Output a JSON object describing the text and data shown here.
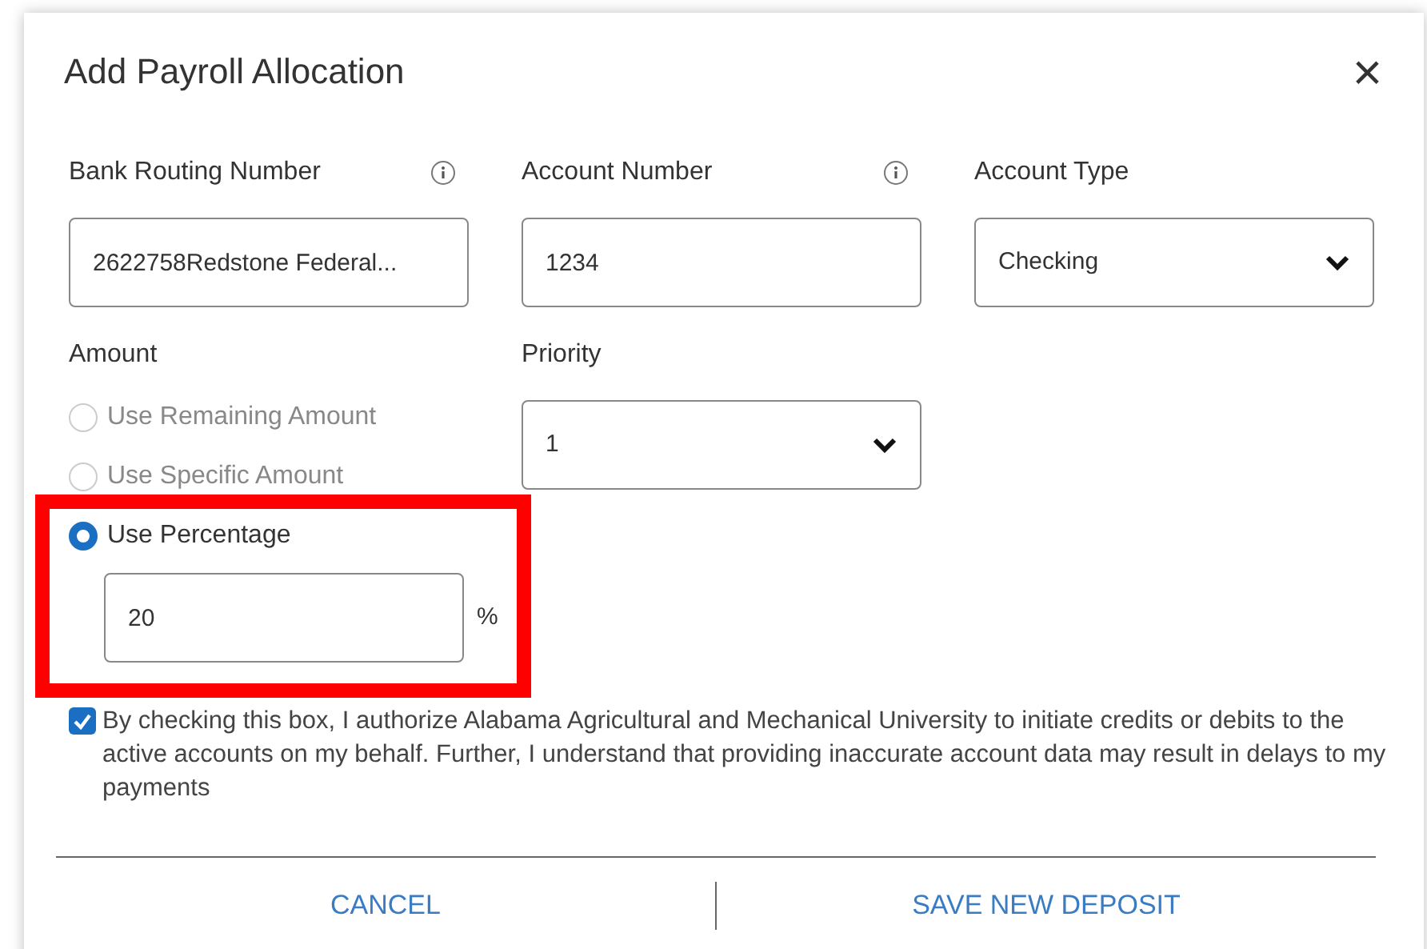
{
  "dialog": {
    "title": "Add Payroll Allocation",
    "close": "×"
  },
  "fields": [
    {
      "label": "Bank Routing Number",
      "info": true,
      "kind": "input",
      "value": "2622758Redstone Federal..."
    },
    {
      "label": "Account Number",
      "info": true,
      "kind": "input",
      "value": "1234"
    },
    {
      "label": "Account Type",
      "info": false,
      "kind": "select",
      "value": "Checking"
    }
  ],
  "amount": {
    "label": "Amount",
    "options": [
      {
        "label": "Use Remaining Amount",
        "selected": false,
        "disabled": true
      },
      {
        "label": "Use Specific Amount",
        "selected": false,
        "disabled": true
      },
      {
        "label": "Use Percentage",
        "selected": true,
        "disabled": false
      }
    ],
    "percentage": {
      "value": "20",
      "unit": "%"
    },
    "highlighted": true
  },
  "priority": {
    "label": "Priority",
    "value": "1"
  },
  "consent": {
    "checked": true,
    "text": "By checking this box, I authorize Alabama Agricultural and Mechanical University to initiate credits or debits to the active accounts on my behalf. Further, I understand that providing inaccurate account data may result in delays to my payments"
  },
  "buttons": [
    "CANCEL",
    "SAVE NEW DEPOSIT"
  ]
}
